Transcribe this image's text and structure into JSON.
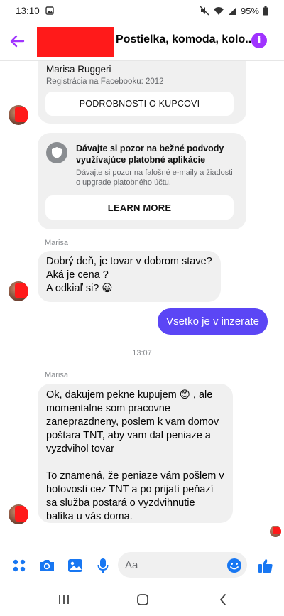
{
  "status_bar": {
    "time": "13:10",
    "battery": "95%"
  },
  "header": {
    "title": "Postielka, komoda, kolo..."
  },
  "buyer_card": {
    "name": "Marisa Ruggeri",
    "registered": "Registrácia na Facebooku: 2012",
    "details_button": "PODROBNOSTI O KUPCOVI"
  },
  "warning_card": {
    "title": "Dávajte si pozor na bežné podvody využívajúce platobné aplikácie",
    "text": "Dávajte si pozor na falošné e-maily a žiadosti o upgrade platobného účtu.",
    "button": "LEARN MORE"
  },
  "messages": [
    {
      "sender": "Marisa",
      "lines": [
        "Dobrý deň, je tovar v dobrom stave?",
        "Aká je cena ?",
        "A odkiaľ si? 😀"
      ]
    },
    {
      "outgoing": "Vsetko je v inzerate"
    },
    {
      "timestamp": "13:07"
    },
    {
      "sender": "Marisa",
      "lines": [
        "Ok, dakujem pekne kupujem 😊 , ale",
        "momentalne som pracovne",
        "zaneprazdneny, poslem k vam domov",
        "poštara TNT, aby vam dal peniaze a",
        "vyzdvihol tovar",
        "",
        "To znamená, že peniaze vám pošlem v",
        "hotovosti cez TNT a po prijatí peňazí",
        "sa služba postará o vyzdvihnutie",
        "balíka u vás doma."
      ]
    }
  ],
  "composer": {
    "placeholder": "Aa"
  },
  "colors": {
    "accent": "#a033ff",
    "outgoing_bubble": "#5b46f5",
    "icon_blue": "#1877f2",
    "redaction": "#ff1a1a"
  }
}
